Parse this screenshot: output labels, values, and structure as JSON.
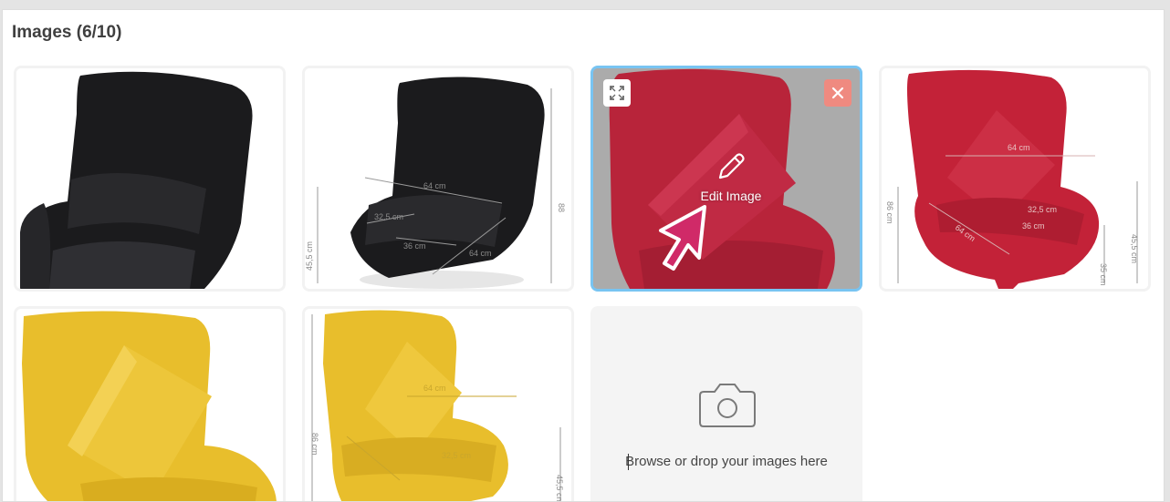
{
  "section": {
    "title": "Images (6/10)"
  },
  "colors": {
    "black_chair": "#1b1b1d",
    "red_chair": "#b8243a",
    "yellow_chair": "#e8be2c",
    "selected_border": "#78c4f2",
    "remove_button": "#ef8a80",
    "cursor_fill": "#d02a68"
  },
  "images": [
    {
      "name": "black chair front",
      "dimensions": []
    },
    {
      "name": "black chair dimensions",
      "dimensions": [
        "64 cm",
        "32,5 cm",
        "36 cm",
        "64 cm",
        "45,5 cm",
        "88"
      ]
    },
    {
      "name": "red chair with cushion",
      "selected": true,
      "dimensions": []
    },
    {
      "name": "red chair dimensions",
      "dimensions": [
        "64 cm",
        "32,5 cm",
        "36 cm",
        "64 cm",
        "86 cm",
        "45,5 cm",
        "35 cm"
      ]
    },
    {
      "name": "yellow chair with cushion",
      "dimensions": []
    },
    {
      "name": "yellow chair dimensions",
      "dimensions": [
        "86 cm",
        "45,5 cm",
        "64 cm",
        "32,5 cm"
      ]
    }
  ],
  "selected_tile": {
    "edit_label": "Edit Image",
    "expand_icon": "expand-icon",
    "remove_icon": "close-icon",
    "edit_icon": "pencil-icon"
  },
  "dropzone": {
    "icon": "camera-icon",
    "text": "Browse or drop your images here"
  }
}
